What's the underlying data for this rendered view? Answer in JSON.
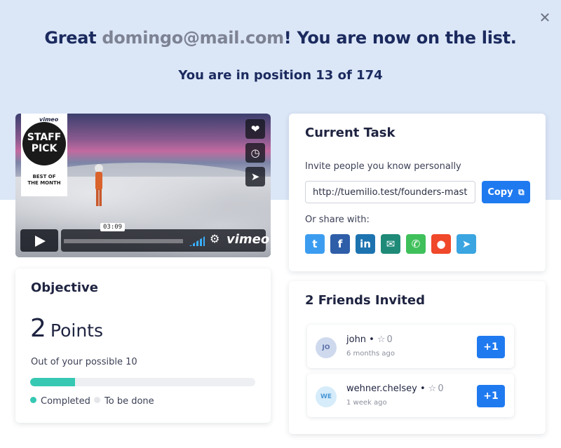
{
  "header": {
    "headline_prefix": "Great ",
    "email": "domingo@mail.com",
    "headline_suffix": "! You are now on the list.",
    "position_text": "You are in position 13 of 174",
    "close_icon": "close-icon"
  },
  "video": {
    "badge_brand": "vimeo",
    "badge_title_line1": "STAFF",
    "badge_title_line2": "PICK",
    "badge_sub_line1": "BEST OF",
    "badge_sub_line2": "THE MONTH",
    "time": "03:09",
    "logo_text": "vimeo",
    "side_icons": [
      "heart-icon",
      "clock-icon",
      "send-icon"
    ]
  },
  "objective": {
    "title": "Objective",
    "points_value": "2",
    "points_unit": "Points",
    "possible_text": "Out of your possible 10",
    "progress_fraction": 0.2,
    "legend_completed": "Completed",
    "legend_todo": "To be done",
    "colors": {
      "completed": "#36c8b2",
      "todo": "#e5e6ea"
    }
  },
  "task": {
    "title": "Current Task",
    "invite_label": "Invite people you know personally",
    "url_value": "http://tuemilio.test/founders-master",
    "copy_label": "Copy",
    "share_label": "Or share with:",
    "share_buttons": [
      {
        "name": "twitter",
        "glyph": "t",
        "color": "#3c9df0"
      },
      {
        "name": "facebook",
        "glyph": "f",
        "color": "#2f5ea8"
      },
      {
        "name": "linkedin",
        "glyph": "in",
        "color": "#1d73b0"
      },
      {
        "name": "email",
        "glyph": "✉",
        "color": "#1f8a78"
      },
      {
        "name": "whatsapp",
        "glyph": "✆",
        "color": "#3fc05a"
      },
      {
        "name": "reddit",
        "glyph": "●",
        "color": "#f0482a"
      },
      {
        "name": "telegram",
        "glyph": "➤",
        "color": "#3aa5e0"
      }
    ]
  },
  "friends": {
    "title": "2 Friends Invited",
    "items": [
      {
        "initials": "JO",
        "name": "john",
        "score": "0",
        "ago": "6 months ago",
        "plus_label": "+1",
        "avatar_bg": "#cfd9ee",
        "avatar_fg": "#5a6fa8"
      },
      {
        "initials": "WE",
        "name": "wehner.chelsey",
        "score": "0",
        "ago": "1 week ago",
        "plus_label": "+1",
        "avatar_bg": "#d6ecfa",
        "avatar_fg": "#4a98d8"
      }
    ]
  }
}
